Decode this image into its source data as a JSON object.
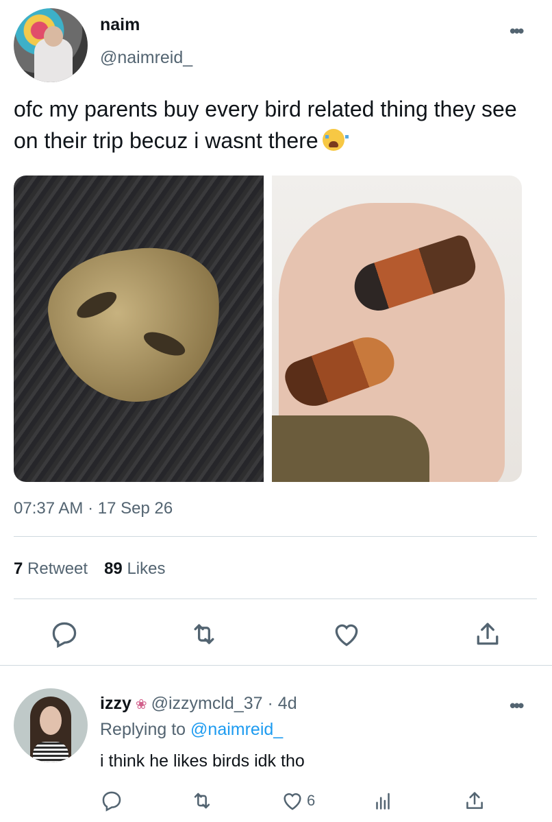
{
  "tweet": {
    "author_name": "naim",
    "author_handle": "@naimreid_",
    "text": "ofc my parents buy every bird related thing they see on their trip becuz i wasnt there",
    "emoji": "loudly-crying-face",
    "timestamp": "07:37 AM · 17 Sep 26",
    "retweet_count": "7",
    "retweet_label": "Retweet",
    "likes_count": "89",
    "likes_label": "Likes",
    "more_label": "•••"
  },
  "media": [
    {
      "name": "engraved brass guitar pick with birds on slate"
    },
    {
      "name": "two carved wooden robin figurines on a palm"
    }
  ],
  "actions": [
    "reply-icon",
    "retweet-icon",
    "like-icon",
    "share-icon"
  ],
  "reply": {
    "author_name": "izzy",
    "badge": "lotus-icon",
    "author_handle": "@izzymcld_37",
    "separator": "·",
    "age": "4d",
    "replying_prefix": "Replying to",
    "replying_to": "@naimreid_",
    "text": "i think he likes birds idk tho",
    "like_count": "6",
    "more_label": "•••"
  },
  "colors": {
    "text": "#0f1419",
    "secondary": "#536471",
    "link": "#1d9bf0",
    "divider": "#cfd9de"
  }
}
